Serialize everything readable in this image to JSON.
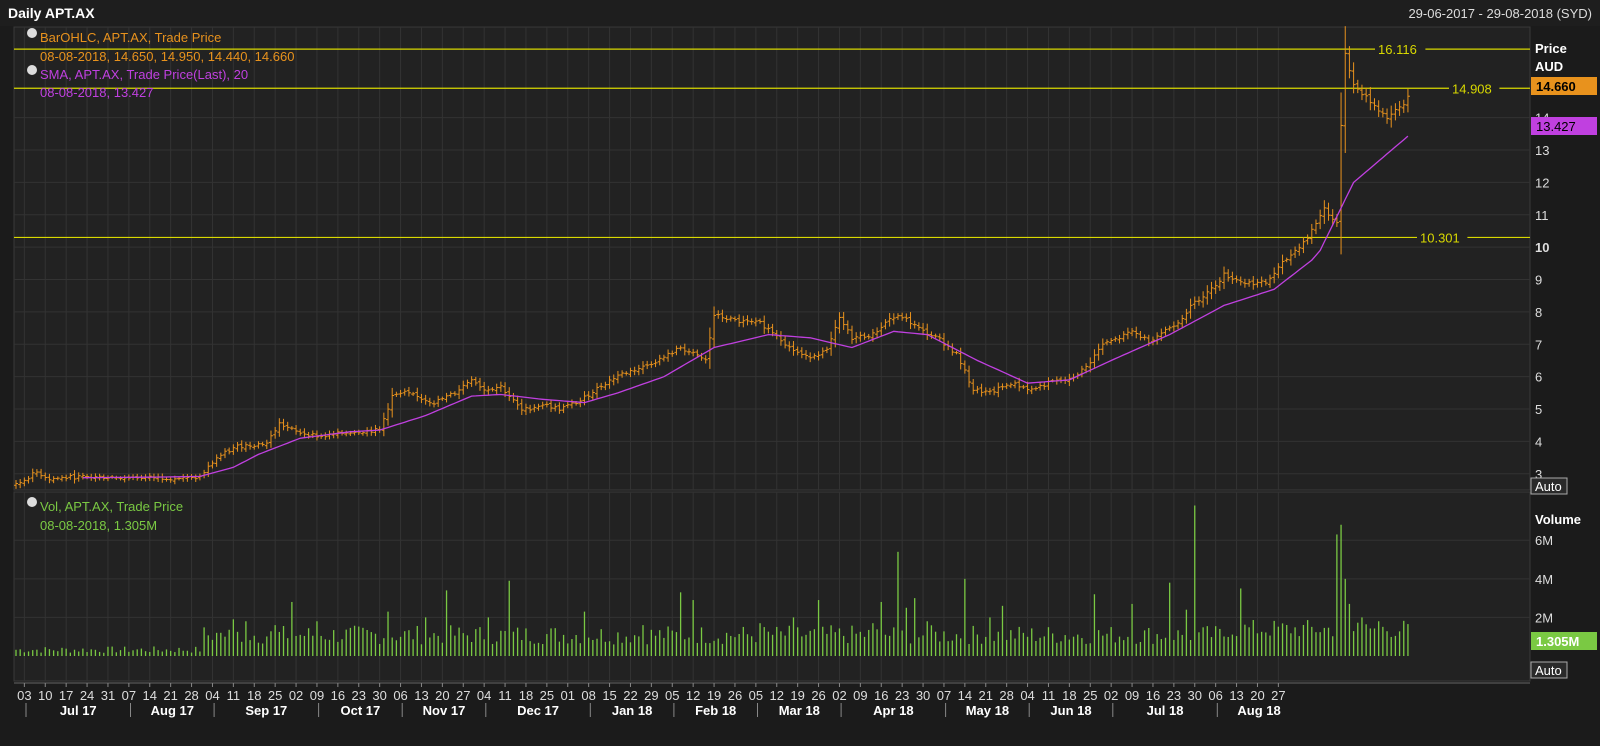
{
  "header": {
    "title": "Daily APT.AX",
    "date_range": "29-06-2017 - 29-08-2018 (SYD)"
  },
  "colors": {
    "background": "#1b1b1b",
    "panel": "#222222",
    "grid": "#333333",
    "price_bars": "#e8921d",
    "sma": "#c040e0",
    "volume": "#7ac943",
    "hline": "#d8d800"
  },
  "price_panel": {
    "legend": {
      "ohlc_title": "BarOHLC, APT.AX, Trade Price",
      "ohlc_values": "08-08-2018, 14.650, 14.950, 14.440, 14.660",
      "sma_title": "SMA, APT.AX, Trade Price(Last),  20",
      "sma_values": "08-08-2018, 13.427"
    },
    "axis_title_1": "Price",
    "axis_title_2": "AUD",
    "last_price_label": "14.660",
    "sma_last_label": "13.427",
    "auto_label": "Auto",
    "hline_labels": [
      "16.116",
      "14.908",
      "10.301"
    ]
  },
  "volume_panel": {
    "legend": {
      "title": "Vol, APT.AX, Trade Price",
      "values": "08-08-2018, 1.305M"
    },
    "axis_title": "Volume",
    "last_volume_label": "1.305M",
    "auto_label": "Auto"
  },
  "chart_data": {
    "type": "bar",
    "price_axis": {
      "ylim": [
        2.5,
        16.8
      ],
      "ticks": [
        "3",
        "4",
        "5",
        "6",
        "7",
        "8",
        "9",
        "10",
        "11",
        "12",
        "13",
        "14"
      ],
      "bold_tick": "10"
    },
    "horizontal_lines": [
      16.116,
      14.908,
      10.301
    ],
    "price_path": [
      [
        2.65,
        0
      ],
      [
        2.9,
        3
      ],
      [
        3.05,
        5
      ],
      [
        2.85,
        8
      ],
      [
        2.9,
        14
      ],
      [
        2.9,
        22
      ],
      [
        2.88,
        35
      ],
      [
        2.85,
        42
      ],
      [
        2.9,
        44
      ],
      [
        3.5,
        48
      ],
      [
        3.85,
        53
      ],
      [
        3.95,
        60
      ],
      [
        4.55,
        63
      ],
      [
        4.3,
        67
      ],
      [
        4.15,
        73
      ],
      [
        4.3,
        80
      ],
      [
        4.35,
        87
      ],
      [
        5.4,
        90
      ],
      [
        5.5,
        93
      ],
      [
        5.2,
        100
      ],
      [
        5.5,
        105
      ],
      [
        5.95,
        109
      ],
      [
        5.6,
        112
      ],
      [
        5.7,
        116
      ],
      [
        4.95,
        121
      ],
      [
        5.15,
        126
      ],
      [
        5.0,
        130
      ],
      [
        5.25,
        135
      ],
      [
        5.55,
        138
      ],
      [
        6.05,
        144
      ],
      [
        6.3,
        150
      ],
      [
        6.6,
        155
      ],
      [
        6.9,
        159
      ],
      [
        6.5,
        165
      ],
      [
        7.9,
        167
      ],
      [
        7.7,
        173
      ],
      [
        7.65,
        178
      ],
      [
        7.3,
        182
      ],
      [
        6.9,
        185
      ],
      [
        6.6,
        189
      ],
      [
        6.8,
        194
      ],
      [
        7.8,
        197
      ],
      [
        7.2,
        200
      ],
      [
        7.3,
        205
      ],
      [
        7.8,
        209
      ],
      [
        7.85,
        212
      ],
      [
        7.4,
        217
      ],
      [
        7.15,
        221
      ],
      [
        6.7,
        225
      ],
      [
        5.6,
        229
      ],
      [
        5.5,
        233
      ],
      [
        5.8,
        238
      ],
      [
        5.6,
        243
      ],
      [
        5.85,
        248
      ],
      [
        5.9,
        252
      ],
      [
        6.3,
        256
      ],
      [
        7.0,
        260
      ],
      [
        7.2,
        264
      ],
      [
        7.4,
        267
      ],
      [
        7.1,
        271
      ],
      [
        7.7,
        278
      ],
      [
        8.3,
        282
      ],
      [
        8.7,
        286
      ],
      [
        9.15,
        289
      ],
      [
        8.9,
        294
      ],
      [
        8.9,
        299
      ],
      [
        9.5,
        303
      ],
      [
        10.3,
        309
      ],
      [
        11.2,
        313
      ],
      [
        10.7,
        316
      ],
      [
        13.8,
        317
      ],
      [
        16.0,
        318
      ],
      [
        15.0,
        320
      ],
      [
        14.5,
        324
      ],
      [
        14.0,
        328
      ],
      [
        14.4,
        332
      ],
      [
        14.66,
        333
      ]
    ],
    "sma_path": [
      [
        2.88,
        16
      ],
      [
        2.9,
        35
      ],
      [
        2.92,
        44
      ],
      [
        3.2,
        52
      ],
      [
        3.6,
        58
      ],
      [
        4.1,
        68
      ],
      [
        4.3,
        80
      ],
      [
        4.35,
        87
      ],
      [
        4.8,
        98
      ],
      [
        5.4,
        109
      ],
      [
        5.45,
        116
      ],
      [
        5.3,
        126
      ],
      [
        5.2,
        136
      ],
      [
        5.5,
        144
      ],
      [
        6.0,
        155
      ],
      [
        6.9,
        167
      ],
      [
        7.3,
        180
      ],
      [
        7.2,
        190
      ],
      [
        6.9,
        200
      ],
      [
        7.4,
        210
      ],
      [
        7.3,
        218
      ],
      [
        6.5,
        230
      ],
      [
        5.8,
        242
      ],
      [
        5.9,
        252
      ],
      [
        6.5,
        262
      ],
      [
        7.3,
        276
      ],
      [
        8.2,
        289
      ],
      [
        8.7,
        301
      ],
      [
        9.6,
        310
      ],
      [
        9.9,
        312
      ],
      [
        12.0,
        320
      ],
      [
        13.43,
        333
      ]
    ],
    "volume_axis": {
      "ylim": [
        0,
        8.5
      ],
      "unit": "M",
      "ticks": [
        "2M",
        "4M",
        "6M"
      ]
    },
    "volume_spikes": [
      [
        48,
        1.2
      ],
      [
        52,
        1.9
      ],
      [
        55,
        1.8
      ],
      [
        62,
        1.6
      ],
      [
        66,
        2.8
      ],
      [
        72,
        1.8
      ],
      [
        89,
        2.3
      ],
      [
        98,
        2.0
      ],
      [
        103,
        3.4
      ],
      [
        113,
        2.0
      ],
      [
        118,
        3.9
      ],
      [
        136,
        2.3
      ],
      [
        150,
        1.6
      ],
      [
        159,
        3.3
      ],
      [
        162,
        2.9
      ],
      [
        178,
        1.7
      ],
      [
        186,
        2.0
      ],
      [
        192,
        2.9
      ],
      [
        205,
        1.7
      ],
      [
        207,
        2.8
      ],
      [
        211,
        5.4
      ],
      [
        213,
        2.5
      ],
      [
        215,
        3.0
      ],
      [
        218,
        1.8
      ],
      [
        227,
        4.0
      ],
      [
        233,
        2.0
      ],
      [
        236,
        2.6
      ],
      [
        258,
        3.2
      ],
      [
        267,
        2.7
      ],
      [
        276,
        3.8
      ],
      [
        280,
        2.4
      ],
      [
        282,
        7.8
      ],
      [
        293,
        3.5
      ],
      [
        316,
        6.3
      ],
      [
        317,
        6.8
      ],
      [
        318,
        4.0
      ],
      [
        319,
        2.7
      ],
      [
        322,
        2.0
      ],
      [
        326,
        1.8
      ]
    ],
    "x_axis": {
      "day_labels": [
        "03",
        "10",
        "17",
        "24",
        "31",
        "07",
        "14",
        "21",
        "28",
        "04",
        "11",
        "18",
        "25",
        "02",
        "09",
        "16",
        "23",
        "30",
        "06",
        "13",
        "20",
        "27",
        "04",
        "11",
        "18",
        "25",
        "01",
        "08",
        "15",
        "22",
        "29",
        "05",
        "12",
        "19",
        "26",
        "05",
        "12",
        "19",
        "26",
        "02",
        "09",
        "16",
        "23",
        "30",
        "07",
        "14",
        "21",
        "28",
        "04",
        "11",
        "18",
        "25",
        "02",
        "09",
        "16",
        "23",
        "30",
        "06",
        "13",
        "20",
        "27"
      ],
      "month_labels": [
        "Jul 17",
        "Aug 17",
        "Sep 17",
        "Oct 17",
        "Nov 17",
        "Dec 17",
        "Jan 18",
        "Feb 18",
        "Mar 18",
        "Apr 18",
        "May 18",
        "Jun 18",
        "Jul 18",
        "Aug 18"
      ]
    }
  }
}
